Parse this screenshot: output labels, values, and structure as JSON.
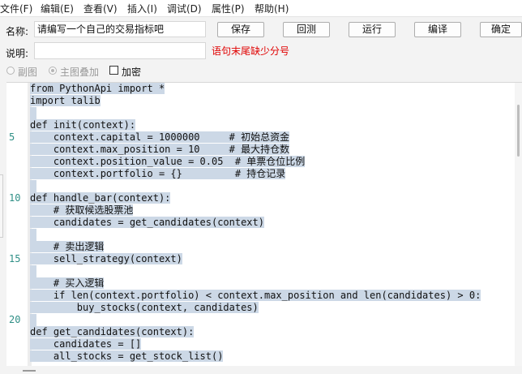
{
  "menu": [
    "文件(F)",
    "编辑(E)",
    "查看(V)",
    "插入(I)",
    "调试(D)",
    "属性(P)",
    "帮助(H)"
  ],
  "name_label": "名称:",
  "name_value": "请编写一个自己的交易指标吧",
  "desc_label": "说明:",
  "desc_value": "",
  "buttons": {
    "save": "保存",
    "undo": "回测",
    "run": "运行",
    "compile": "编译",
    "ok": "确定"
  },
  "error_text": "语句末尾缺少分号",
  "options": {
    "subchart": "副图",
    "main_overlay": "主图叠加",
    "encrypt": "加密"
  },
  "line_numbers": [
    "5",
    "10",
    "15",
    "20"
  ],
  "code_lines": [
    "from PythonApi import *",
    "import talib",
    "",
    "def init(context):",
    "    context.capital = 1000000     # 初始总资金",
    "    context.max_position = 10     # 最大持仓数",
    "    context.position_value = 0.05  # 单票仓位比例",
    "    context.portfolio = {}         # 持仓记录",
    "",
    "def handle_bar(context):",
    "    # 获取候选股票池",
    "    candidates = get_candidates(context)",
    "",
    "    # 卖出逻辑",
    "    sell_strategy(context)",
    "",
    "    # 买入逻辑",
    "    if len(context.portfolio) < context.max_position and len(candidates) > 0:",
    "        buy_stocks(context, candidates)",
    "",
    "def get_candidates(context):",
    "    candidates = []",
    "    all_stocks = get_stock_list()"
  ]
}
